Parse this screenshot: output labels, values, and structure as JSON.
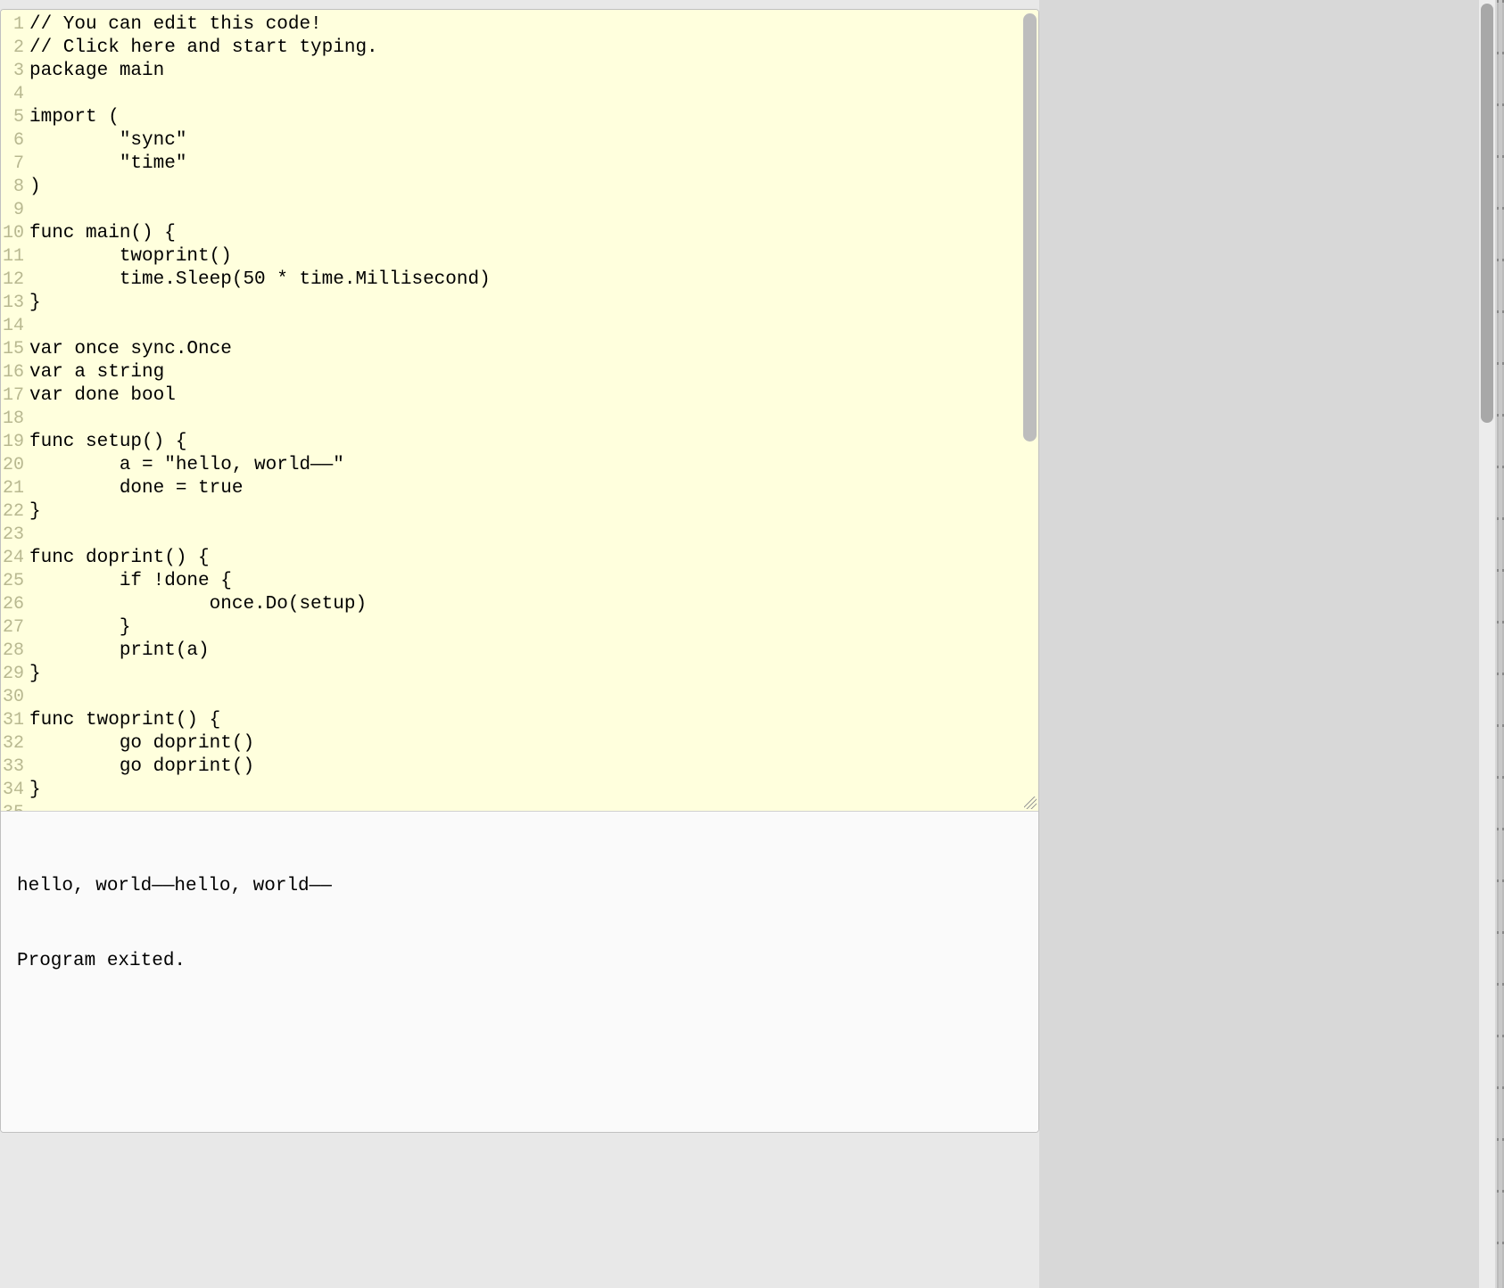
{
  "editor": {
    "background": "#ffffdd",
    "lines": [
      "// You can edit this code!",
      "// Click here and start typing.",
      "package main",
      "",
      "import (",
      "        \"sync\"",
      "        \"time\"",
      ")",
      "",
      "func main() {",
      "        twoprint()",
      "        time.Sleep(50 * time.Millisecond)",
      "}",
      "",
      "var once sync.Once",
      "var a string",
      "var done bool",
      "",
      "func setup() {",
      "        a = \"hello, world——\"",
      "        done = true",
      "}",
      "",
      "func doprint() {",
      "        if !done {",
      "                once.Do(setup)",
      "        }",
      "        print(a)",
      "}",
      "",
      "func twoprint() {",
      "        go doprint()",
      "        go doprint()",
      "}"
    ]
  },
  "output": {
    "line1": "hello, world——hello, world——",
    "line2": "Program exited."
  }
}
